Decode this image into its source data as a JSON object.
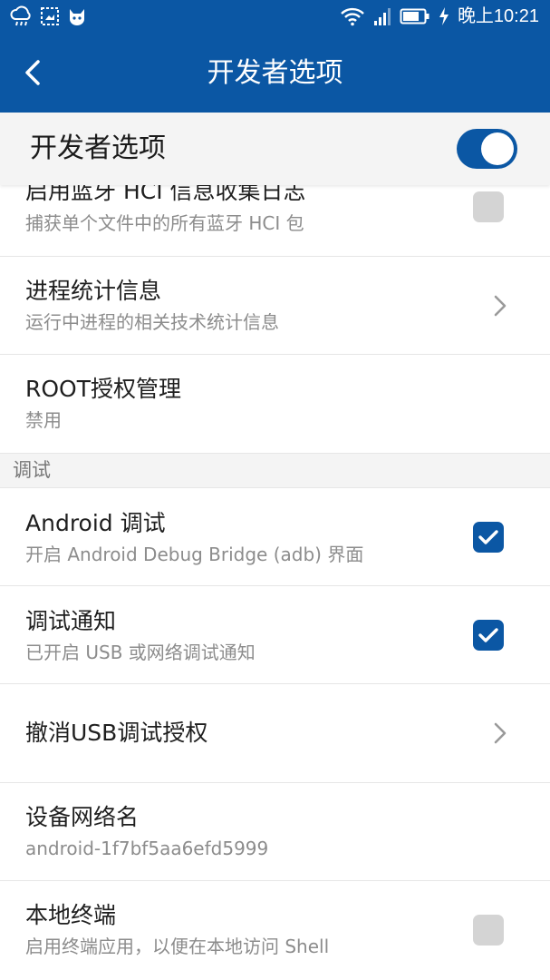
{
  "status_bar": {
    "time": "晚上10:21",
    "left_icons": [
      "cloud-rain-icon",
      "image-icon",
      "cat-icon"
    ],
    "right_icons": [
      "wifi-icon",
      "signal-icon",
      "battery-icon",
      "charging-icon"
    ]
  },
  "app_bar": {
    "title": "开发者选项"
  },
  "master_switch": {
    "label": "开发者选项",
    "enabled": true
  },
  "items": [
    {
      "title": "启用蓝牙 HCI 信息收集日志",
      "subtitle": "捕获单个文件中的所有蓝牙 HCI 包",
      "control": "checkbox",
      "checked": false
    },
    {
      "title": "进程统计信息",
      "subtitle": "运行中进程的相关技术统计信息",
      "control": "chevron"
    },
    {
      "title": "ROOT授权管理",
      "subtitle": "禁用",
      "control": "none"
    }
  ],
  "section": {
    "label": "调试"
  },
  "debug_items": [
    {
      "title": "Android 调试",
      "subtitle": "开启 Android Debug Bridge (adb) 界面",
      "control": "checkbox",
      "checked": true
    },
    {
      "title": "调试通知",
      "subtitle": "已开启 USB 或网络调试通知",
      "control": "checkbox",
      "checked": true
    },
    {
      "title": "撤消USB调试授权",
      "control": "chevron"
    },
    {
      "title": "设备网络名",
      "subtitle": "android-1f7bf5aa6efd5999",
      "control": "none"
    },
    {
      "title": "本地终端",
      "subtitle": "启用终端应用，以便在本地访问 Shell",
      "control": "checkbox",
      "checked": false
    }
  ],
  "colors": {
    "primary": "#0b57a4",
    "checkbox_off": "#d4d4d4",
    "section_bg": "#f4f4f4"
  }
}
